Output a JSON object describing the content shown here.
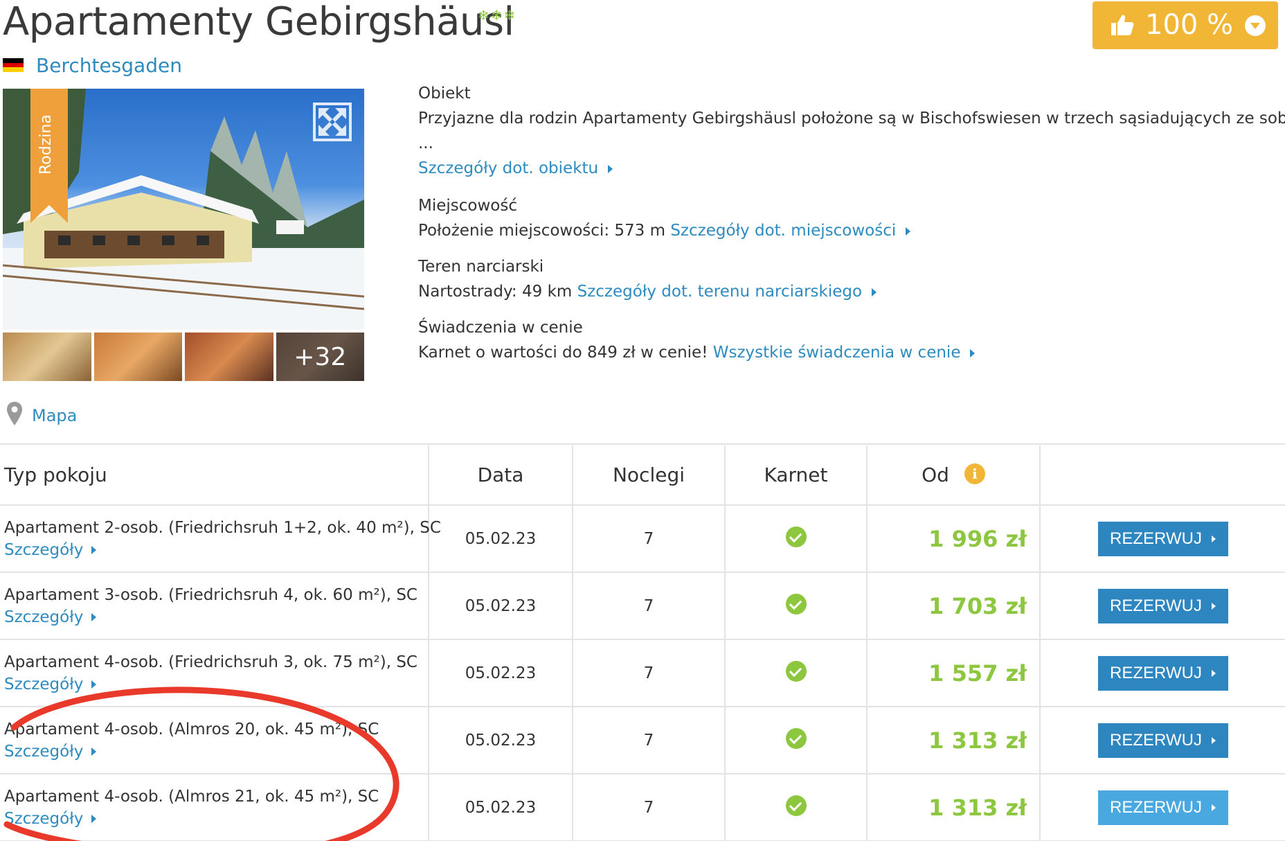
{
  "header": {
    "title": "Apartamenty Gebirgshäusl",
    "stars": "❄❄❄",
    "city": "Berchtesgaden",
    "rating": "100 %",
    "flag_colors": [
      "#000000",
      "#dd0000",
      "#ffce00"
    ]
  },
  "gallery": {
    "ribbon": "Rodzina",
    "more_count": "+32"
  },
  "info": {
    "object_heading": "Obiekt",
    "object_text": "Przyjazne dla rodzin Apartamenty Gebirgshäusl położone są w Bischofswiesen w trzech sąsiadujących ze sobą, ale",
    "object_ellipsis": "...",
    "object_link": "Szczegóły dot. obiektu",
    "place_heading": "Miejscowość",
    "place_text": "Położenie miejscowości: 573 m",
    "place_link": "Szczegóły dot. miejscowości",
    "ski_heading": "Teren narciarski",
    "ski_text": "Nartostrady: 49 km",
    "ski_link": "Szczegóły dot. terenu narciarskiego",
    "services_heading": "Świadczenia w cenie",
    "services_text": "Karnet o wartości do 849 zł w cenie!",
    "services_link": "Wszystkie świadczenia w cenie"
  },
  "map": {
    "label": "Mapa"
  },
  "table": {
    "headers": {
      "room": "Typ pokoju",
      "date": "Data",
      "nights": "Noclegi",
      "pass": "Karnet",
      "from": "Od",
      "info": "i"
    },
    "details_label": "Szczegóły",
    "book_label": "REZERWUJ",
    "rows": [
      {
        "room": "Apartament 2-osob. (Friedrichsruh 1+2, ok. 40 m²), SC",
        "date": "05.02.23",
        "nights": "7",
        "price": "1 996 zł"
      },
      {
        "room": "Apartament 3-osob. (Friedrichsruh 4, ok. 60 m²), SC",
        "date": "05.02.23",
        "nights": "7",
        "price": "1 703 zł"
      },
      {
        "room": "Apartament 4-osob. (Friedrichsruh 3, ok. 75 m²), SC",
        "date": "05.02.23",
        "nights": "7",
        "price": "1 557 zł"
      },
      {
        "room": "Apartament 4-osob. (Almros 20, ok. 45 m²), SC",
        "date": "05.02.23",
        "nights": "7",
        "price": "1 313 zł"
      },
      {
        "room": "Apartament 4-osob. (Almros 21, ok. 45 m²), SC",
        "date": "05.02.23",
        "nights": "7",
        "price": "1 313 zł"
      }
    ]
  },
  "colors": {
    "link": "#2e8bc0",
    "price": "#8dc63f",
    "button": "#2e86c1",
    "rating": "#f2b636",
    "annotation": "#e8392a"
  }
}
